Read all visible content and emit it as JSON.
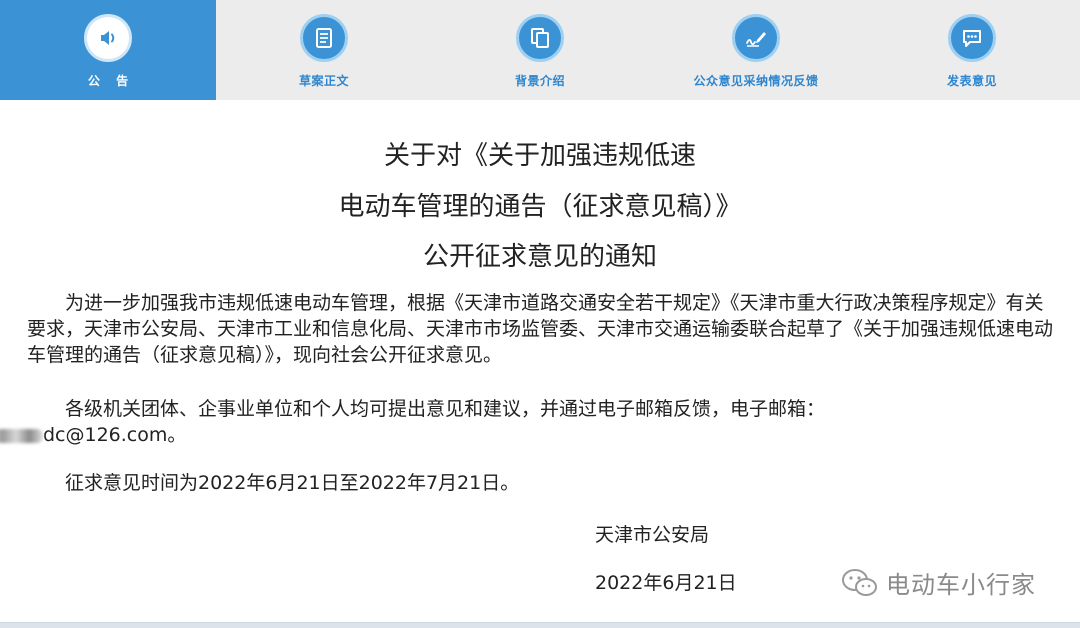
{
  "tabs": [
    {
      "label": "公 告",
      "icon": "speaker-icon",
      "active": true
    },
    {
      "label": "草案正文",
      "icon": "document-icon",
      "active": false
    },
    {
      "label": "背景介绍",
      "icon": "copy-pages-icon",
      "active": false
    },
    {
      "label": "公众意见采纳情况反馈",
      "icon": "pen-signature-icon",
      "active": false
    },
    {
      "label": "发表意见",
      "icon": "chat-bubble-icon",
      "active": false
    }
  ],
  "notice": {
    "title_line1": "关于对《关于加强违规低速",
    "title_line2": "电动车管理的通告（征求意见稿）》",
    "title_line3": "公开征求意见的通知",
    "paragraph1": "为进一步加强我市违规低速电动车管理，根据《天津市道路交通安全若干规定》《天津市重大行政决策程序规定》有关要求，天津市公安局、天津市工业和信息化局、天津市市场监管委、天津市交通运输委联合起草了《关于加强违规低速电动车管理的通告（征求意见稿）》，现向社会公开征求意见。",
    "paragraph2": "各级机关团体、企事业单位和个人均可提出意见和建议，并通过电子邮箱反馈，电子邮箱：",
    "email_visible": "dc@126.com。",
    "paragraph3": "征求意见时间为2022年6月21日至2022年7月21日。",
    "signer": "天津市公安局",
    "date": "2022年6月21日"
  },
  "watermark": {
    "text": "电动车小行家",
    "icon": "wechat-icon"
  },
  "colors": {
    "accent": "#3b93d6",
    "tab_bg": "#ececec",
    "label": "#2d86cf"
  }
}
